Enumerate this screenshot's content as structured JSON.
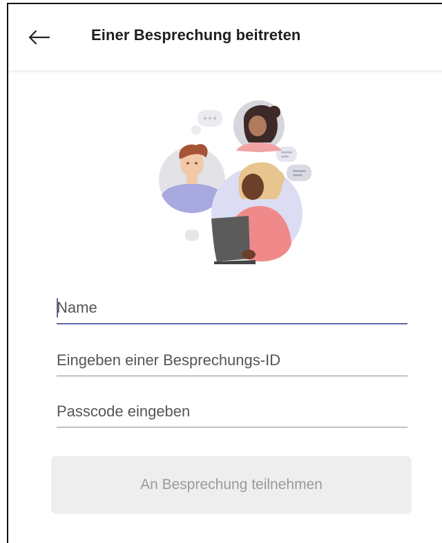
{
  "header": {
    "title": "Einer Besprechung beitreten",
    "back_icon": "arrow-left-icon"
  },
  "form": {
    "name_placeholder": "Name",
    "name_value": "",
    "meeting_id_placeholder": "Eingeben einer Besprechungs-ID",
    "meeting_id_value": "",
    "passcode_placeholder": "Passcode eingeben",
    "passcode_value": ""
  },
  "join_button": {
    "label": "An Besprechung teilnehmen",
    "state": "disabled"
  },
  "colors": {
    "accent": "#6264a7",
    "button_bg": "#eeeeee",
    "button_text": "#9a9a9a"
  }
}
